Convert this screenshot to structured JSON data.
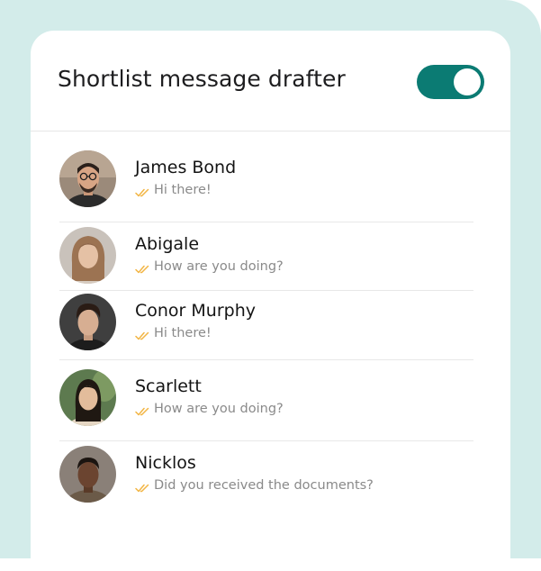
{
  "header": {
    "title": "Shortlist message drafter",
    "toggle_on": true
  },
  "colors": {
    "background": "#d3ecea",
    "accent": "#0b7b73",
    "read_check": "#f2b544"
  },
  "contacts": [
    {
      "name": "James Bond",
      "last_message": "Hi there!"
    },
    {
      "name": "Abigale",
      "last_message": "How are you doing?"
    },
    {
      "name": "Conor Murphy",
      "last_message": "Hi there!"
    },
    {
      "name": "Scarlett",
      "last_message": "How are you doing?"
    },
    {
      "name": "Nicklos",
      "last_message": "Did you received the documents?"
    }
  ],
  "icons": {
    "read_receipt": "double-check-icon",
    "toggle": "toggle-switch"
  }
}
